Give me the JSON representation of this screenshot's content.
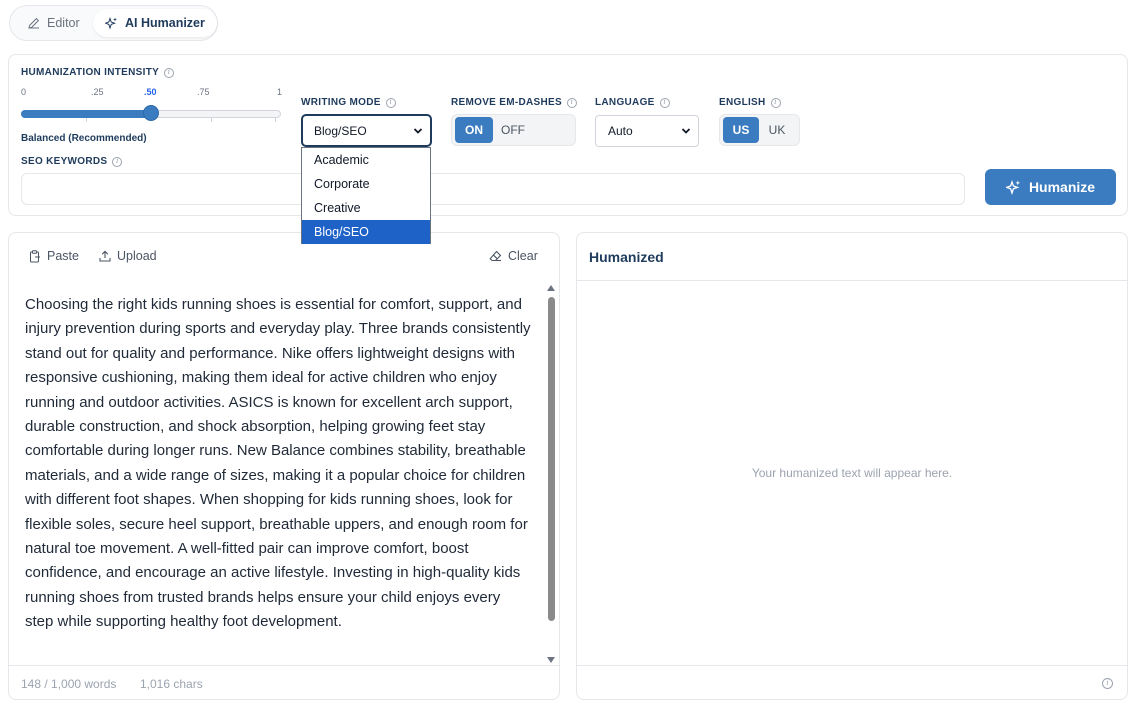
{
  "tabs": {
    "editor": "Editor",
    "humanizer": "AI Humanizer"
  },
  "intensity": {
    "label": "HUMANIZATION INTENSITY",
    "ticks": [
      "0",
      ".25",
      ".50",
      ".75",
      "1"
    ],
    "value": 0.5,
    "caption": "Balanced (Recommended)"
  },
  "writing_mode": {
    "label": "WRITING MODE",
    "selected": "Blog/SEO",
    "options": [
      "Academic",
      "Corporate",
      "Creative",
      "Blog/SEO"
    ]
  },
  "em_dashes": {
    "label": "REMOVE EM-DASHES",
    "on": "ON",
    "off": "OFF"
  },
  "language": {
    "label": "LANGUAGE",
    "selected": "Auto"
  },
  "english": {
    "label": "ENGLISH",
    "us": "US",
    "uk": "UK"
  },
  "seo": {
    "label": "SEO KEYWORDS",
    "value": ""
  },
  "humanize_button": "Humanize",
  "editor": {
    "paste": "Paste",
    "upload": "Upload",
    "clear": "Clear",
    "text": "Choosing the right kids running shoes is essential for comfort, support, and injury prevention during sports and everyday play. Three brands consistently stand out for quality and performance. Nike offers lightweight designs with responsive cushioning, making them ideal for active children who enjoy running and outdoor activities. ASICS is known for excellent arch support, durable construction, and shock absorption, helping growing feet stay comfortable during longer runs. New Balance combines stability, breathable materials, and a wide range of sizes, making it a popular choice for children with different foot shapes. When shopping for kids running shoes, look for flexible soles, secure heel support, breathable uppers, and enough room for natural toe movement. A well-fitted pair can improve comfort, boost confidence, and encourage an active lifestyle. Investing in high-quality kids running shoes from trusted brands helps ensure your child enjoys every step while supporting healthy foot development.",
    "word_count": "148 / 1,000 words",
    "char_count": "1,016 chars"
  },
  "output": {
    "title": "Humanized",
    "placeholder": "Your humanized text will appear here."
  },
  "colors": {
    "accent": "#3b7bbf",
    "heading": "#1f3b5c",
    "dropdown_highlight": "#1e62c7"
  }
}
